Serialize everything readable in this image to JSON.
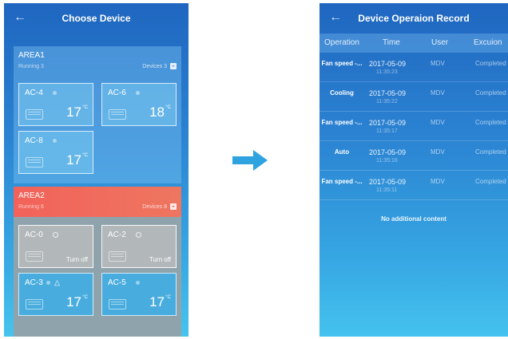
{
  "left_screen": {
    "title": "Choose Device",
    "areas": [
      {
        "name": "AREA1",
        "running": "Running 3",
        "devices": "Devices 3",
        "tiles": [
          {
            "name": "AC-4",
            "temp": "17",
            "unit": "°C"
          },
          {
            "name": "AC-6",
            "temp": "18",
            "unit": "°C"
          },
          {
            "name": "AC-8",
            "temp": "17",
            "unit": "°C"
          }
        ]
      },
      {
        "name": "AREA2",
        "running": "Running 6",
        "devices": "Devices 8",
        "tiles": [
          {
            "name": "AC-0",
            "status": "Turn off"
          },
          {
            "name": "AC-2",
            "status": "Turn off"
          },
          {
            "name": "AC-3",
            "temp": "17",
            "unit": "°C"
          },
          {
            "name": "AC-5",
            "temp": "17",
            "unit": "°C"
          }
        ]
      }
    ]
  },
  "right_screen": {
    "title": "Device Operaion Record",
    "columns": [
      "Operation",
      "Time",
      "User",
      "Excuion"
    ],
    "rows": [
      {
        "operation": "Fan speed -...",
        "date": "2017-05-09",
        "time": "11:35:23",
        "user": "MDV",
        "status": "Completed"
      },
      {
        "operation": "Cooling",
        "date": "2017-05-09",
        "time": "11:35:22",
        "user": "MDV",
        "status": "Completed"
      },
      {
        "operation": "Fan speed -...",
        "date": "2017-05-09",
        "time": "11:35:17",
        "user": "MDV",
        "status": "Completed"
      },
      {
        "operation": "Auto",
        "date": "2017-05-09",
        "time": "11:35:16",
        "user": "MDV",
        "status": "Completed"
      },
      {
        "operation": "Fan speed -...",
        "date": "2017-05-09",
        "time": "11:35:11",
        "user": "MDV",
        "status": "Completed"
      }
    ],
    "footer": "No additional content"
  },
  "colors": {
    "arrow": "#2fa3e0",
    "area2_header": "#f2625a",
    "background_top": "#1f66c0",
    "background_bottom": "#46c3ee"
  },
  "icons": {
    "back": "back-arrow-icon",
    "transition": "right-arrow-icon",
    "collapse": "collapse-toggle-icon",
    "warning": "warning-icon"
  }
}
